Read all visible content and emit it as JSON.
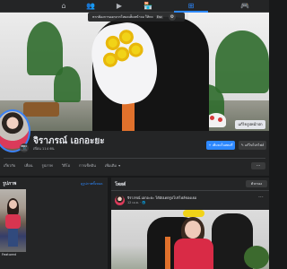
{
  "topnav": {
    "icons": [
      "home-icon",
      "friends-icon",
      "watch-icon",
      "marketplace-icon",
      "groups-icon",
      "gaming-icon"
    ],
    "active_index": 4,
    "glyphs": [
      "⌂",
      "👥",
      "▶",
      "🏪",
      "⊞",
      "🎮"
    ]
  },
  "cover": {
    "alert_text": "หากต้องการออกจากโหมดเต็มหน้าจอ ให้กด",
    "alert_key": "Esc",
    "edit_label": "แก้ไขรูปหน้าปก"
  },
  "profile": {
    "name": "จิราภรณ์ เอกอะยะ",
    "friends": "เพื่อน 114 คน",
    "add_story": "+ เพิ่มลงในสตอรี่",
    "edit_profile": "✎ แก้ไขโปรไฟล์",
    "tabs": [
      "เกี่ยวกับ",
      "เพื่อน",
      "รูปภาพ",
      "วิดีโอ",
      "การเช็คอิน",
      "เพิ่มเติม",
      "▾"
    ],
    "more": "···"
  },
  "left_card": {
    "title": "รูปภาพ",
    "link": "ดูรูปภาพทั้งหมด",
    "tile_label": "Featured"
  },
  "posts": {
    "title": "โพสต์",
    "filter": "ตัวกรอง",
    "author": "จิราภรณ์ เอกอะยะ ได้อัปเดตรูปโปรไฟล์ของเธอ",
    "meta": "12 เม.ย. · 🌐",
    "more": "···"
  },
  "colors": {
    "accent": "#2d88ff",
    "background": "#18191a",
    "card": "#242526"
  }
}
